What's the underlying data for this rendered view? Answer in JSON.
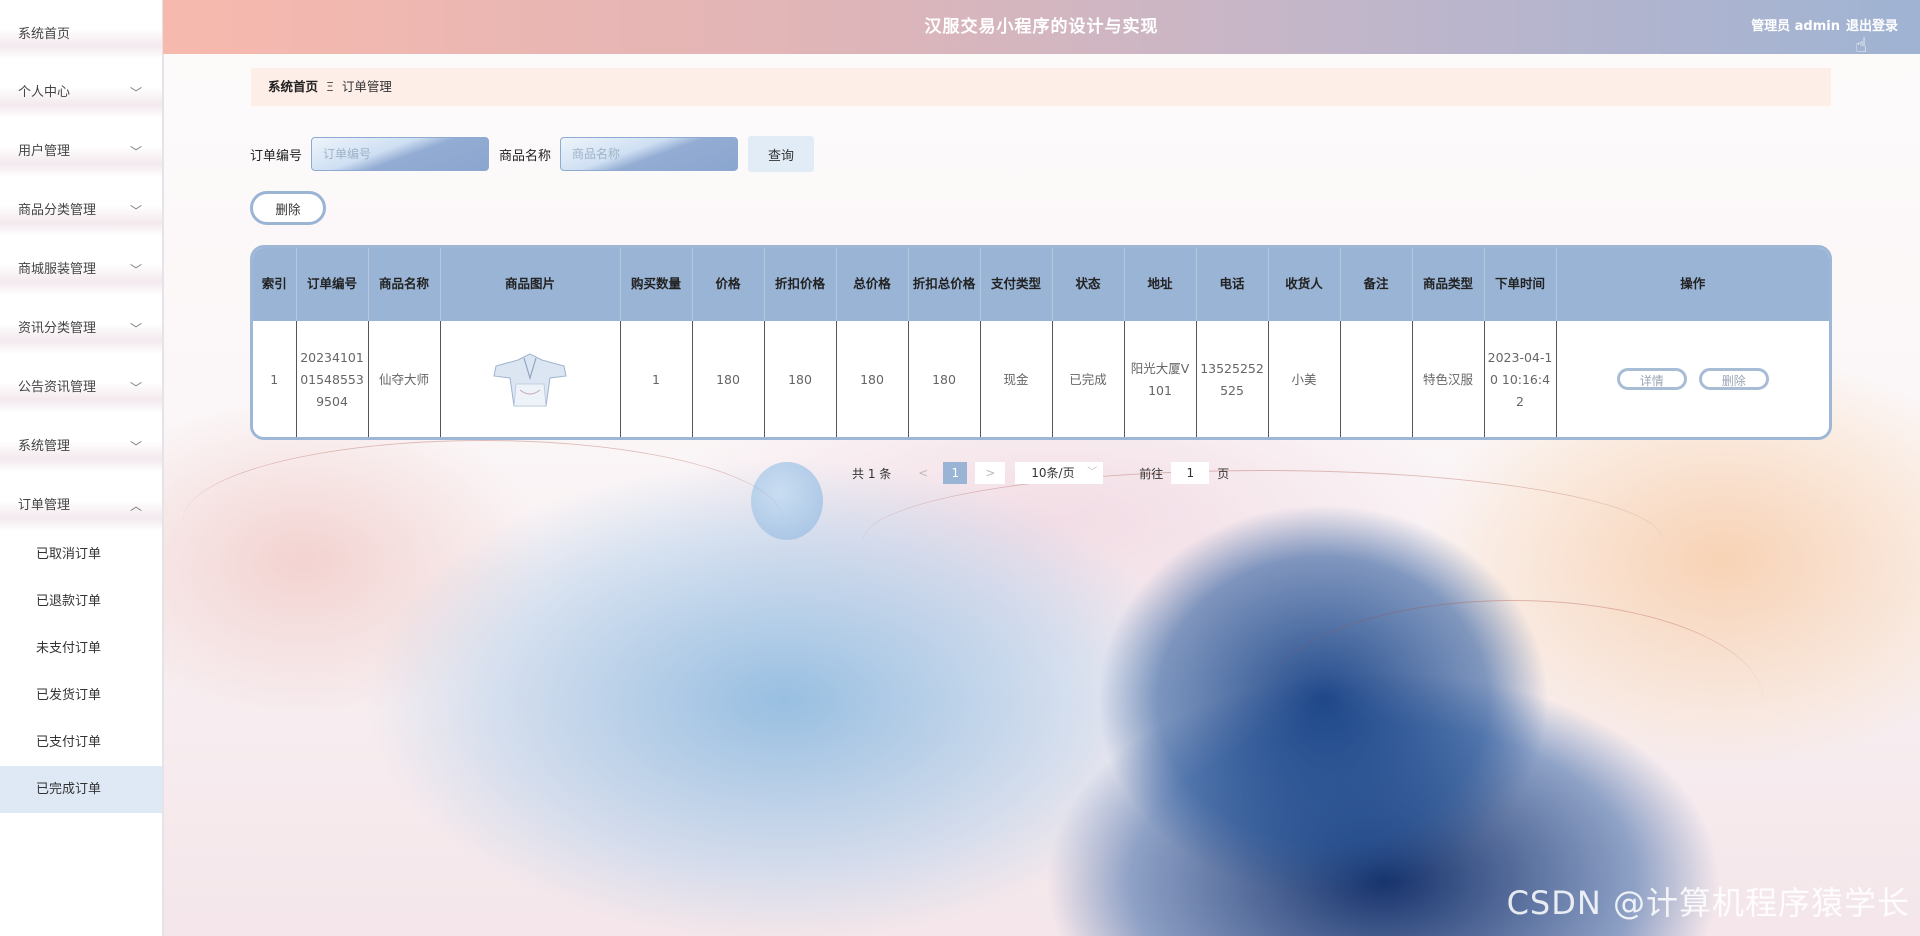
{
  "header": {
    "title": "汉服交易小程序的设计与实现",
    "user": "管理员 admin",
    "logout": "退出登录"
  },
  "sidebar": {
    "items": [
      {
        "label": "系统首页",
        "chevron": ""
      },
      {
        "label": "个人中心",
        "chevron": "﹀"
      },
      {
        "label": "用户管理",
        "chevron": "﹀"
      },
      {
        "label": "商品分类管理",
        "chevron": "﹀"
      },
      {
        "label": "商城服装管理",
        "chevron": "﹀"
      },
      {
        "label": "资讯分类管理",
        "chevron": "﹀"
      },
      {
        "label": "公告资讯管理",
        "chevron": "﹀"
      },
      {
        "label": "系统管理",
        "chevron": "﹀"
      },
      {
        "label": "订单管理",
        "chevron": "︿"
      }
    ],
    "submenu": [
      "已取消订单",
      "已退款订单",
      "未支付订单",
      "已发货订单",
      "已支付订单",
      "已完成订单"
    ]
  },
  "breadcrumb": {
    "home": "系统首页",
    "sep": "Ξ",
    "current": "订单管理"
  },
  "search": {
    "order_label": "订单编号",
    "order_placeholder": "订单编号",
    "name_label": "商品名称",
    "name_placeholder": "商品名称",
    "query_button": "查询"
  },
  "actions": {
    "delete_button": "删除"
  },
  "table": {
    "columns": [
      "索引",
      "订单编号",
      "商品名称",
      "商品图片",
      "购买数量",
      "价格",
      "折扣价格",
      "总价格",
      "折扣总价格",
      "支付类型",
      "状态",
      "地址",
      "电话",
      "收货人",
      "备注",
      "商品类型",
      "下单时间",
      "操作"
    ],
    "rows": [
      {
        "index": "1",
        "order_no": "20234101015485539504",
        "product_name": "仙夺大师",
        "image": "hanfu-image",
        "quantity": "1",
        "price": "180",
        "discount_price": "180",
        "total_price": "180",
        "discount_total": "180",
        "pay_type": "现金",
        "status": "已完成",
        "address": "阳光大厦V101",
        "phone": "13525252525",
        "receiver": "小美",
        "note": "",
        "product_type": "特色汉服",
        "order_time": "2023-04-10 10:16:42",
        "detail_button": "详情",
        "delete_button": "删除"
      }
    ]
  },
  "pagination": {
    "total": "共 1 条",
    "prev": "<",
    "current_page": "1",
    "next": ">",
    "page_size": "10条/页",
    "goto_label": "前往",
    "goto_value": "1",
    "page_unit": "页"
  },
  "watermark": "CSDN @计算机程序猿学长",
  "colors": {
    "header_start": "#f7b9ad",
    "header_end": "#9fb3d3",
    "table_header": "#9ab4d6",
    "active_menu": "#dfe9f6"
  }
}
